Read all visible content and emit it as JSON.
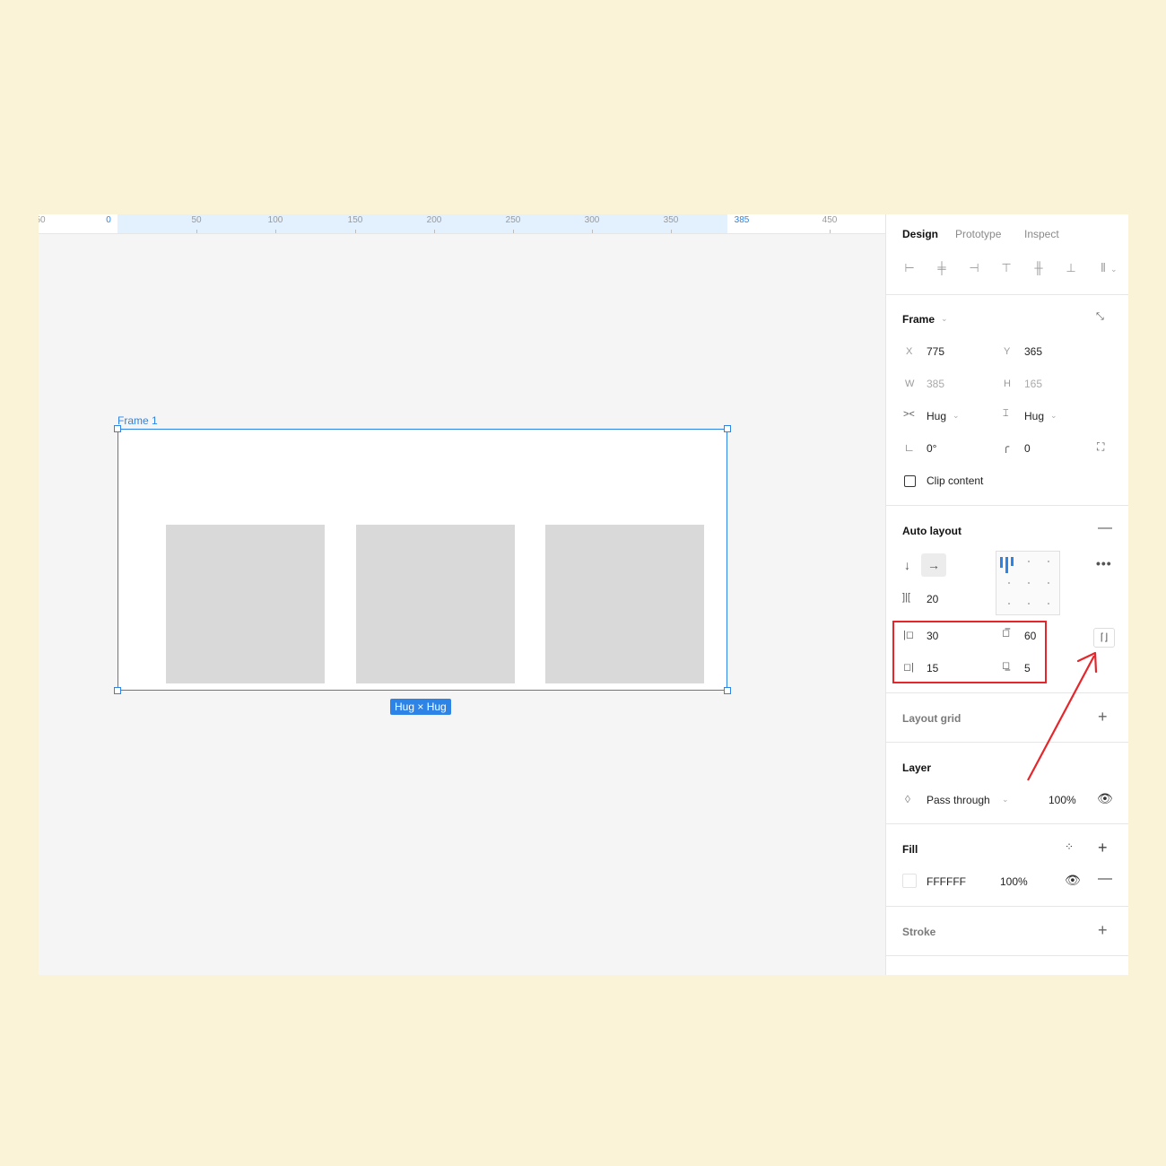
{
  "ruler": {
    "ticks": [
      "50",
      "0",
      "50",
      "100",
      "150",
      "200",
      "250",
      "300",
      "350",
      "385",
      "450"
    ]
  },
  "canvas": {
    "frame_label": "Frame 1",
    "size_badge": "Hug × Hug"
  },
  "panel": {
    "tabs": [
      "Design",
      "Prototype",
      "Inspect"
    ],
    "frame": {
      "title": "Frame",
      "x_label": "X",
      "x_value": "775",
      "y_label": "Y",
      "y_value": "365",
      "w_label": "W",
      "w_value": "385",
      "h_label": "H",
      "h_value": "165",
      "h_resize": "Hug",
      "v_resize": "Hug",
      "rotation": "0°",
      "corner_radius": "0",
      "clip_content": "Clip content"
    },
    "auto_layout": {
      "title": "Auto layout",
      "spacing": "20",
      "padding_left": "30",
      "padding_top": "60",
      "padding_right": "15",
      "padding_bottom": "5"
    },
    "layout_grid": {
      "title": "Layout grid"
    },
    "layer": {
      "title": "Layer",
      "blend_mode": "Pass through",
      "opacity": "100%"
    },
    "fill": {
      "title": "Fill",
      "color_hex": "FFFFFF",
      "opacity": "100%"
    },
    "stroke": {
      "title": "Stroke"
    }
  },
  "colors": {
    "background": "#FBF3D7",
    "accent": "#2D84E6",
    "highlight": "#E5262B"
  }
}
